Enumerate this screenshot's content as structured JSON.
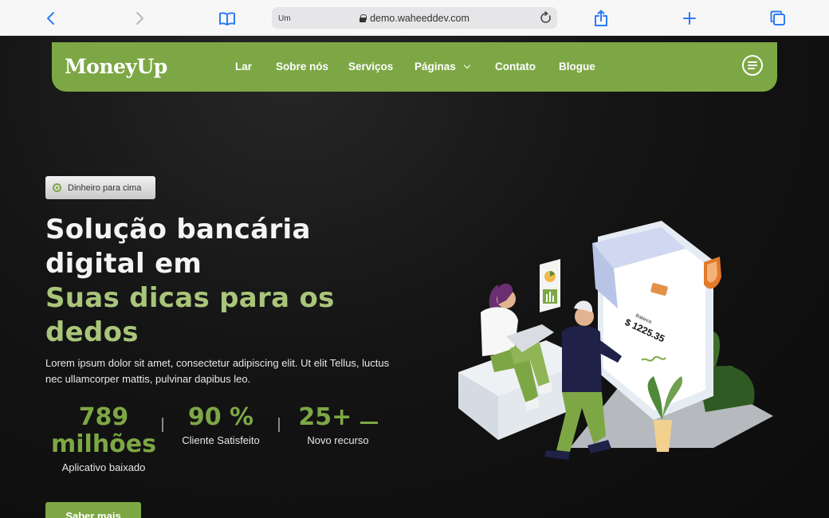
{
  "browser": {
    "tab_text": "Um",
    "url": "demo.waheeddev.com"
  },
  "site": {
    "brand": "MoneyUp",
    "nav": [
      {
        "label": "Lar"
      },
      {
        "label": "Sobre nós"
      },
      {
        "label": "Serviços"
      },
      {
        "label": "Páginas"
      },
      {
        "label": "Contato"
      },
      {
        "label": "Blogue"
      }
    ]
  },
  "hero": {
    "badge": "Dinheiro para cima",
    "title_line1": "Solução bancária",
    "title_line2": "digital em",
    "title_line3": "Suas dicas para os",
    "title_line4": "dedos",
    "description": "Lorem ipsum dolor sit amet, consectetur adipiscing elit. Ut elit Tellus, luctus nec ullamcorper mattis, pulvinar dapibus leo.",
    "stats": [
      {
        "value_line1": "789",
        "value_line2": "milhões",
        "label": "Aplicativo baixado"
      },
      {
        "value_line1": "90 %",
        "label": "Cliente Satisfeito"
      },
      {
        "value_line1": "25+",
        "label": "Novo recurso"
      }
    ],
    "cta": "Saber mais"
  },
  "illustration": {
    "balance_label": "Balance",
    "balance_value": "$ 1225.35"
  },
  "colors": {
    "accent": "#7da745",
    "accent_light": "#a9c57a",
    "background": "#0d0d0d",
    "browser_blue": "#2d7bf6"
  }
}
